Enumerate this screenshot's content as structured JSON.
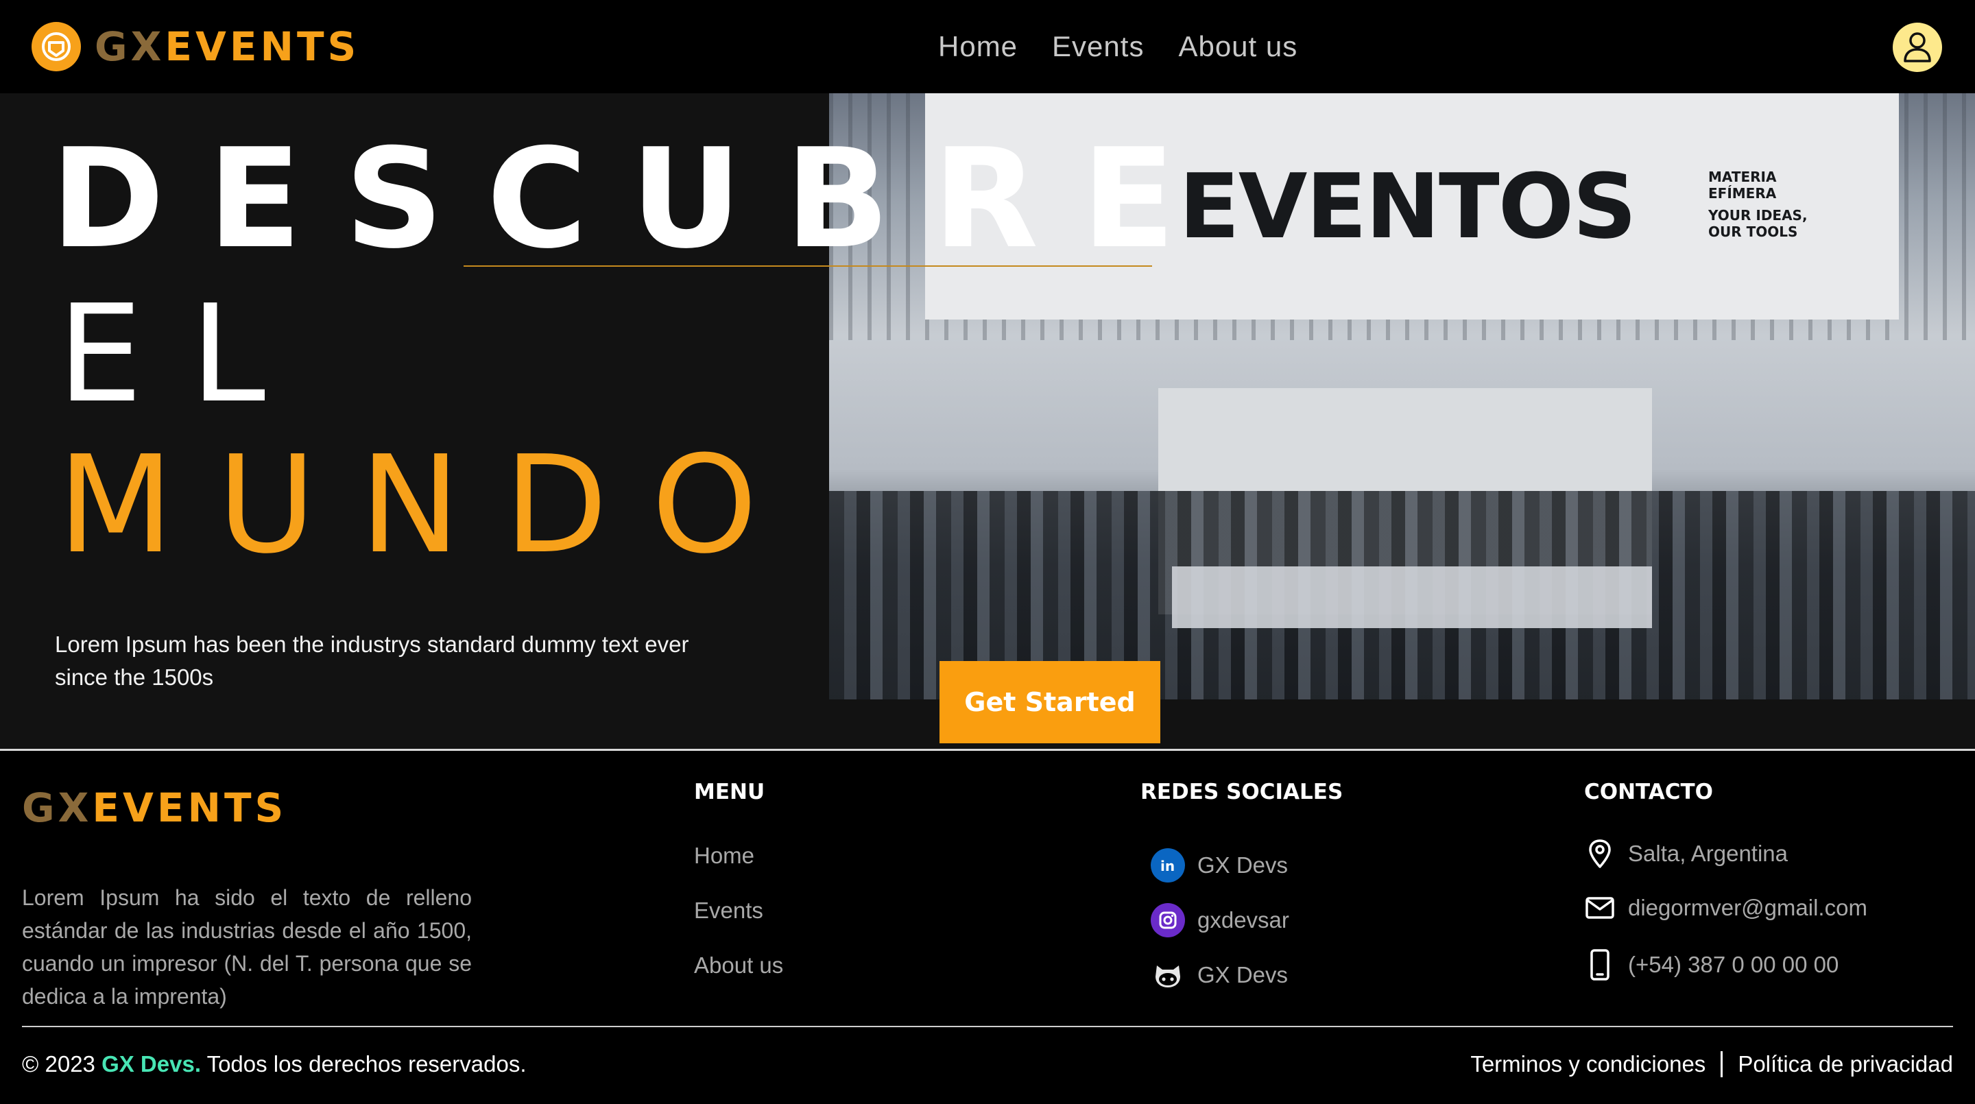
{
  "header": {
    "logo_gx": "GX",
    "logo_events": "EVENTS",
    "nav": [
      "Home",
      "Events",
      "About us"
    ]
  },
  "hero": {
    "line1": "DESCUBRE",
    "line2": "EL",
    "line3": "MUNDO",
    "description": "Lorem Ipsum has been the industrys standard dummy text ever since the 1500s",
    "cta_label": "Get Started",
    "photo": {
      "sign_text": "EVENTOS",
      "brand_line1": "MATERIA",
      "brand_line2": "EFÍMERA",
      "tagline_line1": "YOUR IDEAS,",
      "tagline_line2": "OUR TOOLS"
    }
  },
  "footer": {
    "logo_gx": "GX",
    "logo_events": "EVENTS",
    "description": "Lorem Ipsum ha sido el texto de relleno estándar de las industrias desde el año 1500, cuando un impresor (N. del T. persona que se dedica a la imprenta)",
    "menu": {
      "title": "MENU",
      "items": [
        "Home",
        "Events",
        "About us"
      ]
    },
    "social": {
      "title": "REDES SOCIALES",
      "items": [
        {
          "label": "GX Devs",
          "icon": "linkedin-icon"
        },
        {
          "label": "gxdevsar",
          "icon": "instagram-icon"
        },
        {
          "label": "GX Devs",
          "icon": "github-icon"
        }
      ]
    },
    "contact": {
      "title": "CONTACTO",
      "items": [
        {
          "label": "Salta, Argentina",
          "icon": "location-pin-icon"
        },
        {
          "label": "diegormver@gmail.com",
          "icon": "mail-icon"
        },
        {
          "label": "(+54) 387 0 00 00 00",
          "icon": "phone-icon"
        }
      ]
    },
    "copyright_prefix": "© 2023",
    "copyright_brand": "GX Devs.",
    "copyright_suffix": "Todos los derechos reservados.",
    "legal": [
      "Terminos y condiciones",
      "Política de privacidad"
    ]
  },
  "colors": {
    "accent": "#f7a11a",
    "cta": "#fa9e0f",
    "brand_green": "#48e5b4",
    "avatar_bg": "#fde98c",
    "hero_bg": "#121212"
  }
}
